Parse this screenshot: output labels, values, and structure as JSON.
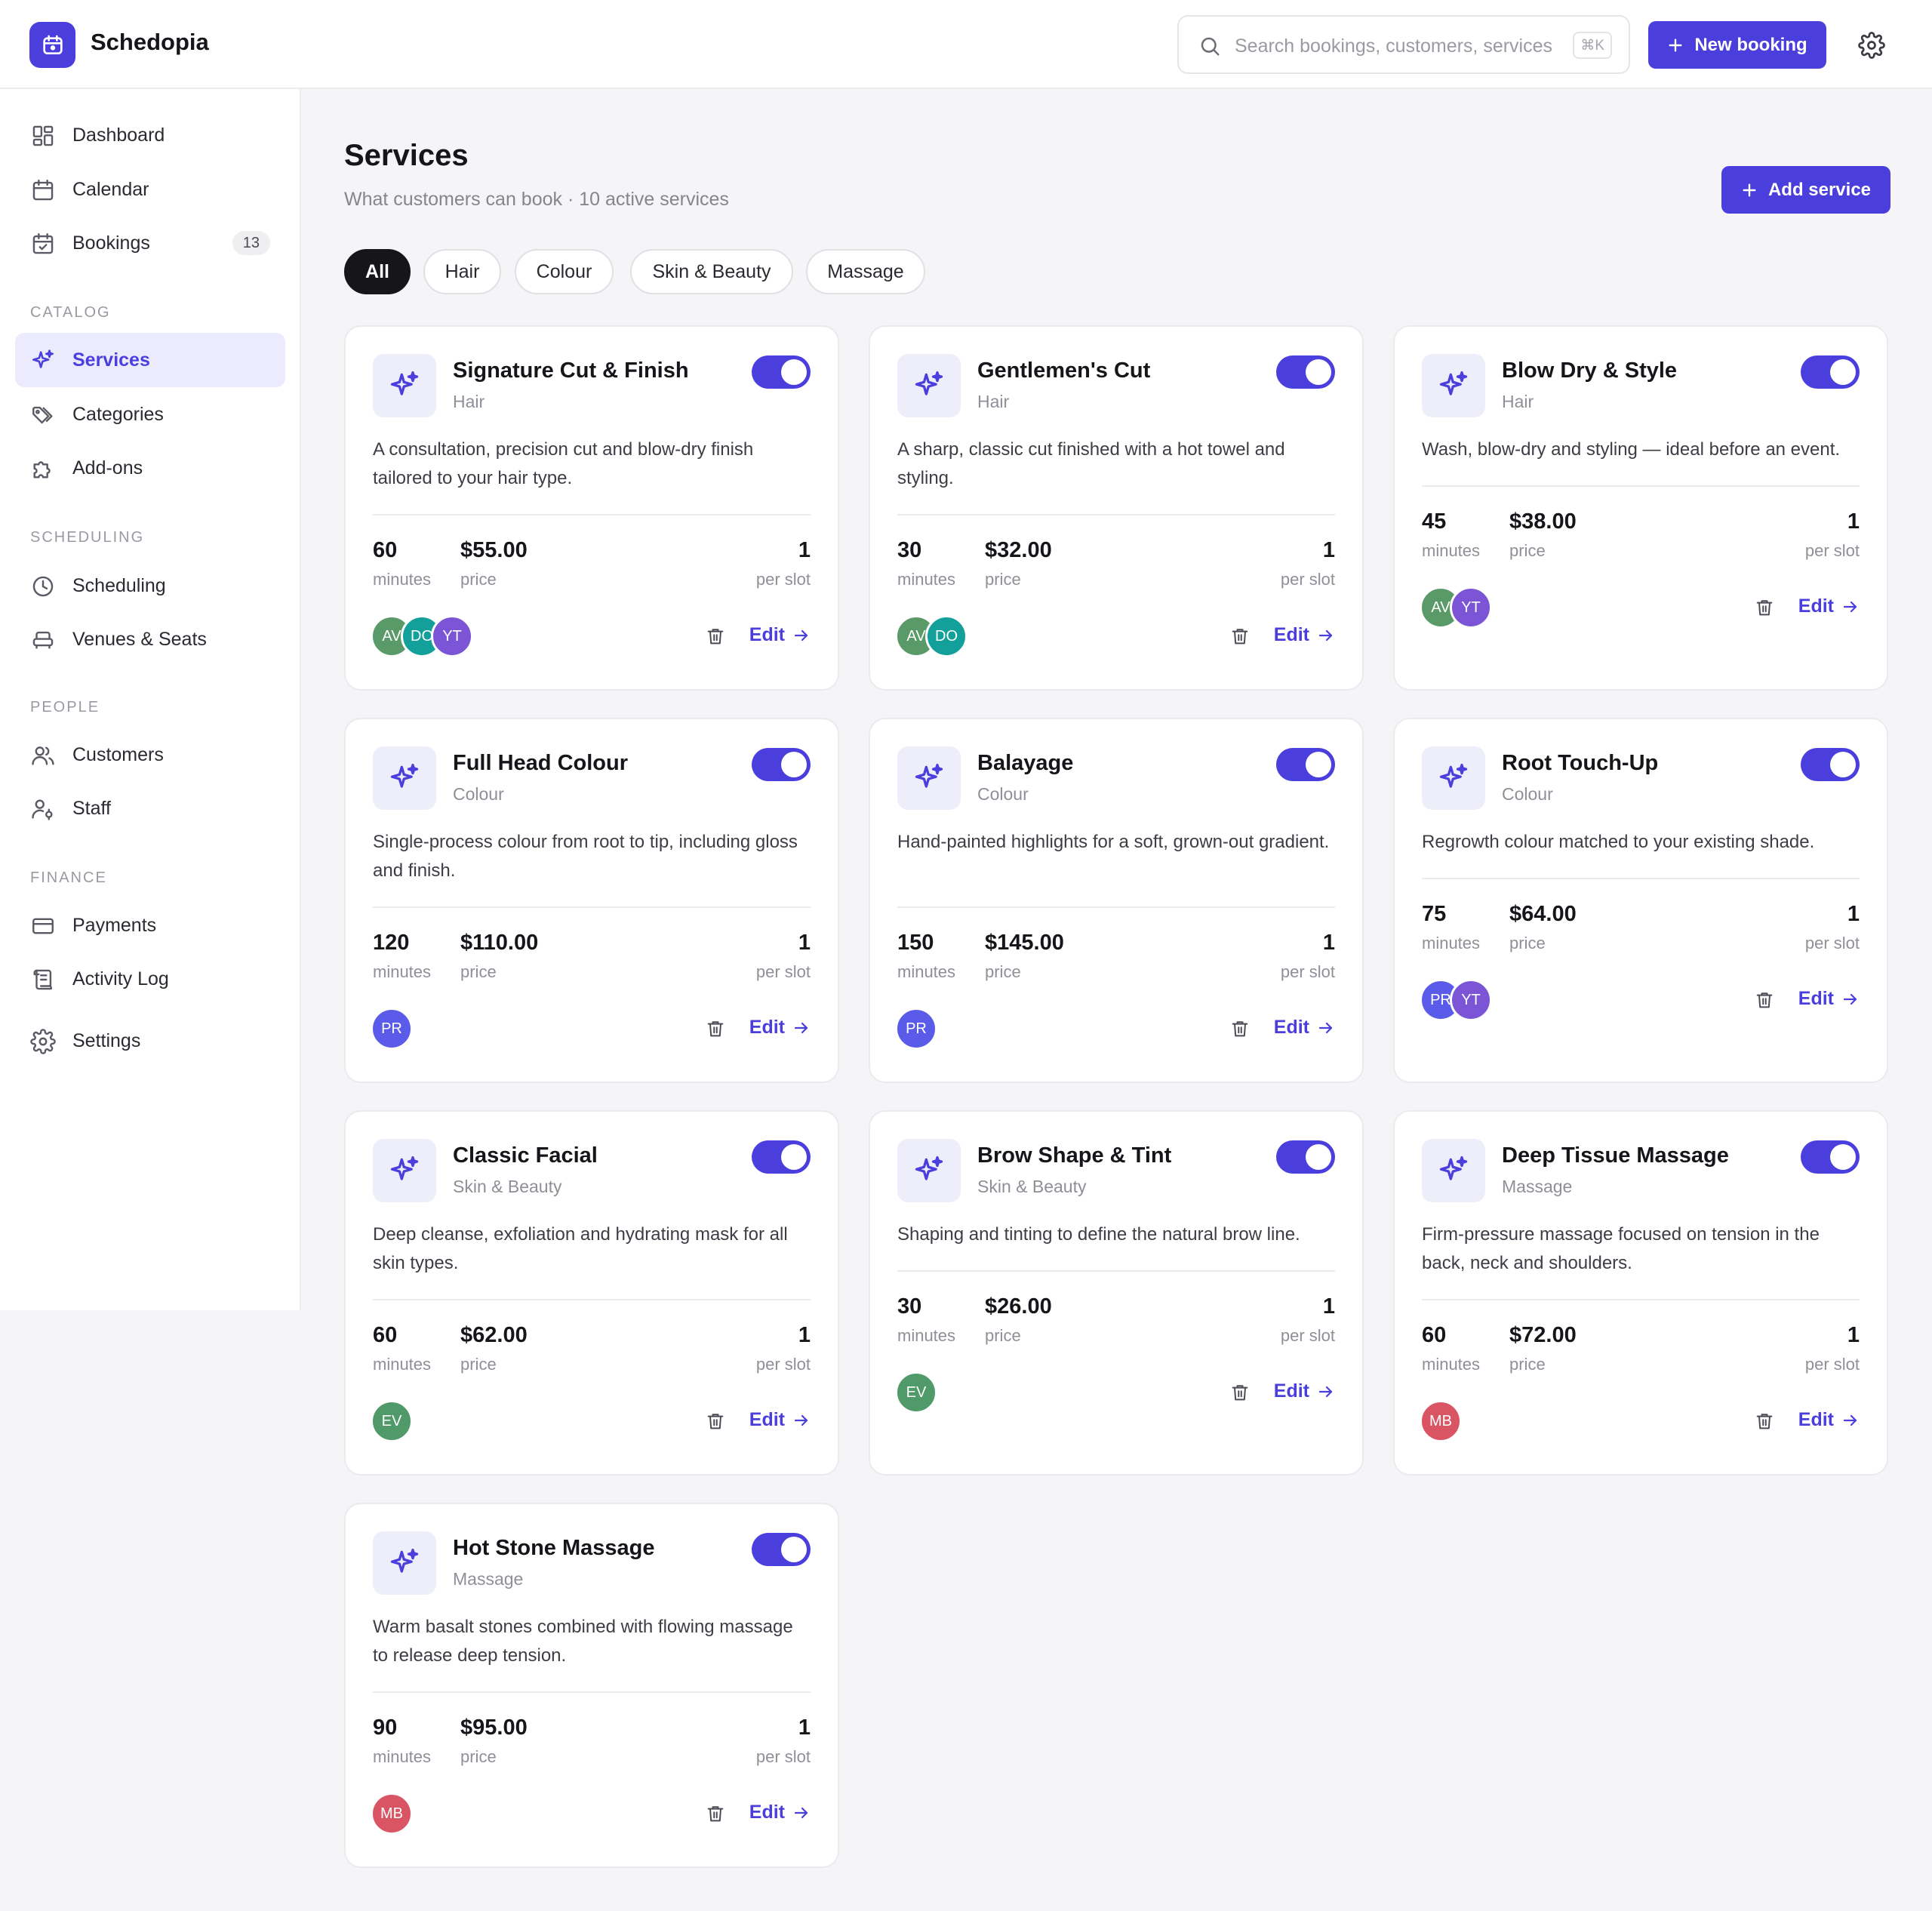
{
  "app": {
    "name": "Schedopia"
  },
  "header": {
    "search_placeholder": "Search bookings, customers, services",
    "shortcut": "⌘K",
    "new_booking_label": "New booking"
  },
  "sidebar": {
    "top_items": [
      {
        "label": "Dashboard",
        "icon": "dashboard-icon"
      },
      {
        "label": "Calendar",
        "icon": "calendar-icon"
      },
      {
        "label": "Bookings",
        "icon": "bookings-icon",
        "badge": "13"
      }
    ],
    "sections": [
      {
        "label": "CATALOG",
        "items": [
          {
            "label": "Services",
            "icon": "sparkle-icon",
            "active": true
          },
          {
            "label": "Categories",
            "icon": "tag-icon"
          },
          {
            "label": "Add-ons",
            "icon": "puzzle-icon"
          }
        ]
      },
      {
        "label": "SCHEDULING",
        "items": [
          {
            "label": "Scheduling",
            "icon": "clock-icon"
          },
          {
            "label": "Venues & Seats",
            "icon": "seat-icon"
          }
        ]
      },
      {
        "label": "PEOPLE",
        "items": [
          {
            "label": "Customers",
            "icon": "users-icon"
          },
          {
            "label": "Staff",
            "icon": "staff-icon"
          }
        ]
      },
      {
        "label": "FINANCE",
        "items": [
          {
            "label": "Payments",
            "icon": "card-icon"
          },
          {
            "label": "Activity Log",
            "icon": "log-icon"
          }
        ]
      }
    ],
    "settings_label": "Settings"
  },
  "page": {
    "title": "Services",
    "subtitle": "What customers can book · 10 active services",
    "add_label": "Add service",
    "filters": [
      "All",
      "Hair",
      "Colour",
      "Skin & Beauty",
      "Massage"
    ],
    "active_filter": "All"
  },
  "labels": {
    "minutes": "minutes",
    "price": "price",
    "per_slot": "per slot",
    "edit": "Edit"
  },
  "colors": {
    "accent": "#4a3fdc",
    "avatar_AV": "#5a9a68",
    "avatar_DO": "#14a09a",
    "avatar_YT": "#7b55d6",
    "avatar_PR": "#5b5bea",
    "avatar_EV": "#4f9a68",
    "avatar_MB": "#d95563"
  },
  "services": [
    {
      "name": "Signature Cut & Finish",
      "category": "Hair",
      "enabled": true,
      "description": "A consultation, precision cut and blow-dry finish tailored to your hair type.",
      "minutes": "60",
      "price": "$55.00",
      "per_slot": "1",
      "staff": [
        "AV",
        "DO",
        "YT"
      ]
    },
    {
      "name": "Gentlemen's Cut",
      "category": "Hair",
      "enabled": true,
      "description": "A sharp, classic cut finished with a hot towel and styling.",
      "minutes": "30",
      "price": "$32.00",
      "per_slot": "1",
      "staff": [
        "AV",
        "DO"
      ]
    },
    {
      "name": "Blow Dry & Style",
      "category": "Hair",
      "enabled": true,
      "description": "Wash, blow-dry and styling — ideal before an event.",
      "minutes": "45",
      "price": "$38.00",
      "per_slot": "1",
      "staff": [
        "AV",
        "YT"
      ]
    },
    {
      "name": "Full Head Colour",
      "category": "Colour",
      "enabled": true,
      "description": "Single-process colour from root to tip, including gloss and finish.",
      "minutes": "120",
      "price": "$110.00",
      "per_slot": "1",
      "staff": [
        "PR"
      ]
    },
    {
      "name": "Balayage",
      "category": "Colour",
      "enabled": true,
      "description": "Hand-painted highlights for a soft, grown-out gradient.",
      "minutes": "150",
      "price": "$145.00",
      "per_slot": "1",
      "staff": [
        "PR"
      ]
    },
    {
      "name": "Root Touch-Up",
      "category": "Colour",
      "enabled": true,
      "description": "Regrowth colour matched to your existing shade.",
      "minutes": "75",
      "price": "$64.00",
      "per_slot": "1",
      "staff": [
        "PR",
        "YT"
      ]
    },
    {
      "name": "Classic Facial",
      "category": "Skin & Beauty",
      "enabled": true,
      "description": "Deep cleanse, exfoliation and hydrating mask for all skin types.",
      "minutes": "60",
      "price": "$62.00",
      "per_slot": "1",
      "staff": [
        "EV"
      ]
    },
    {
      "name": "Brow Shape & Tint",
      "category": "Skin & Beauty",
      "enabled": true,
      "description": "Shaping and tinting to define the natural brow line.",
      "minutes": "30",
      "price": "$26.00",
      "per_slot": "1",
      "staff": [
        "EV"
      ]
    },
    {
      "name": "Deep Tissue Massage",
      "category": "Massage",
      "enabled": true,
      "description": "Firm-pressure massage focused on tension in the back, neck and shoulders.",
      "minutes": "60",
      "price": "$72.00",
      "per_slot": "1",
      "staff": [
        "MB"
      ]
    },
    {
      "name": "Hot Stone Massage",
      "category": "Massage",
      "enabled": true,
      "description": "Warm basalt stones combined with flowing massage to release deep tension.",
      "minutes": "90",
      "price": "$95.00",
      "per_slot": "1",
      "staff": [
        "MB"
      ]
    }
  ]
}
